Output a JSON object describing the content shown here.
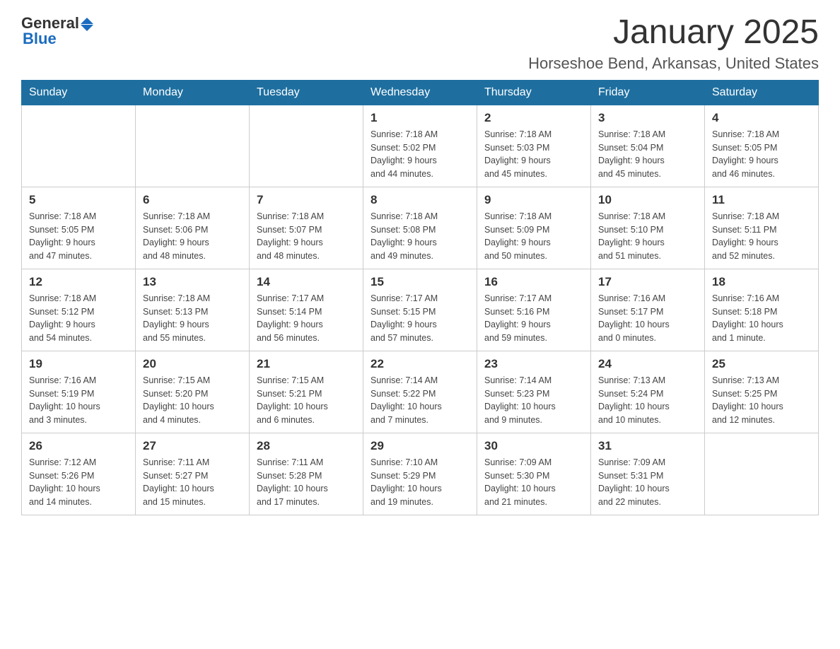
{
  "logo": {
    "general": "General",
    "blue": "Blue"
  },
  "header": {
    "month": "January 2025",
    "location": "Horseshoe Bend, Arkansas, United States"
  },
  "weekdays": [
    "Sunday",
    "Monday",
    "Tuesday",
    "Wednesday",
    "Thursday",
    "Friday",
    "Saturday"
  ],
  "weeks": [
    [
      {
        "day": "",
        "info": ""
      },
      {
        "day": "",
        "info": ""
      },
      {
        "day": "",
        "info": ""
      },
      {
        "day": "1",
        "info": "Sunrise: 7:18 AM\nSunset: 5:02 PM\nDaylight: 9 hours\nand 44 minutes."
      },
      {
        "day": "2",
        "info": "Sunrise: 7:18 AM\nSunset: 5:03 PM\nDaylight: 9 hours\nand 45 minutes."
      },
      {
        "day": "3",
        "info": "Sunrise: 7:18 AM\nSunset: 5:04 PM\nDaylight: 9 hours\nand 45 minutes."
      },
      {
        "day": "4",
        "info": "Sunrise: 7:18 AM\nSunset: 5:05 PM\nDaylight: 9 hours\nand 46 minutes."
      }
    ],
    [
      {
        "day": "5",
        "info": "Sunrise: 7:18 AM\nSunset: 5:05 PM\nDaylight: 9 hours\nand 47 minutes."
      },
      {
        "day": "6",
        "info": "Sunrise: 7:18 AM\nSunset: 5:06 PM\nDaylight: 9 hours\nand 48 minutes."
      },
      {
        "day": "7",
        "info": "Sunrise: 7:18 AM\nSunset: 5:07 PM\nDaylight: 9 hours\nand 48 minutes."
      },
      {
        "day": "8",
        "info": "Sunrise: 7:18 AM\nSunset: 5:08 PM\nDaylight: 9 hours\nand 49 minutes."
      },
      {
        "day": "9",
        "info": "Sunrise: 7:18 AM\nSunset: 5:09 PM\nDaylight: 9 hours\nand 50 minutes."
      },
      {
        "day": "10",
        "info": "Sunrise: 7:18 AM\nSunset: 5:10 PM\nDaylight: 9 hours\nand 51 minutes."
      },
      {
        "day": "11",
        "info": "Sunrise: 7:18 AM\nSunset: 5:11 PM\nDaylight: 9 hours\nand 52 minutes."
      }
    ],
    [
      {
        "day": "12",
        "info": "Sunrise: 7:18 AM\nSunset: 5:12 PM\nDaylight: 9 hours\nand 54 minutes."
      },
      {
        "day": "13",
        "info": "Sunrise: 7:18 AM\nSunset: 5:13 PM\nDaylight: 9 hours\nand 55 minutes."
      },
      {
        "day": "14",
        "info": "Sunrise: 7:17 AM\nSunset: 5:14 PM\nDaylight: 9 hours\nand 56 minutes."
      },
      {
        "day": "15",
        "info": "Sunrise: 7:17 AM\nSunset: 5:15 PM\nDaylight: 9 hours\nand 57 minutes."
      },
      {
        "day": "16",
        "info": "Sunrise: 7:17 AM\nSunset: 5:16 PM\nDaylight: 9 hours\nand 59 minutes."
      },
      {
        "day": "17",
        "info": "Sunrise: 7:16 AM\nSunset: 5:17 PM\nDaylight: 10 hours\nand 0 minutes."
      },
      {
        "day": "18",
        "info": "Sunrise: 7:16 AM\nSunset: 5:18 PM\nDaylight: 10 hours\nand 1 minute."
      }
    ],
    [
      {
        "day": "19",
        "info": "Sunrise: 7:16 AM\nSunset: 5:19 PM\nDaylight: 10 hours\nand 3 minutes."
      },
      {
        "day": "20",
        "info": "Sunrise: 7:15 AM\nSunset: 5:20 PM\nDaylight: 10 hours\nand 4 minutes."
      },
      {
        "day": "21",
        "info": "Sunrise: 7:15 AM\nSunset: 5:21 PM\nDaylight: 10 hours\nand 6 minutes."
      },
      {
        "day": "22",
        "info": "Sunrise: 7:14 AM\nSunset: 5:22 PM\nDaylight: 10 hours\nand 7 minutes."
      },
      {
        "day": "23",
        "info": "Sunrise: 7:14 AM\nSunset: 5:23 PM\nDaylight: 10 hours\nand 9 minutes."
      },
      {
        "day": "24",
        "info": "Sunrise: 7:13 AM\nSunset: 5:24 PM\nDaylight: 10 hours\nand 10 minutes."
      },
      {
        "day": "25",
        "info": "Sunrise: 7:13 AM\nSunset: 5:25 PM\nDaylight: 10 hours\nand 12 minutes."
      }
    ],
    [
      {
        "day": "26",
        "info": "Sunrise: 7:12 AM\nSunset: 5:26 PM\nDaylight: 10 hours\nand 14 minutes."
      },
      {
        "day": "27",
        "info": "Sunrise: 7:11 AM\nSunset: 5:27 PM\nDaylight: 10 hours\nand 15 minutes."
      },
      {
        "day": "28",
        "info": "Sunrise: 7:11 AM\nSunset: 5:28 PM\nDaylight: 10 hours\nand 17 minutes."
      },
      {
        "day": "29",
        "info": "Sunrise: 7:10 AM\nSunset: 5:29 PM\nDaylight: 10 hours\nand 19 minutes."
      },
      {
        "day": "30",
        "info": "Sunrise: 7:09 AM\nSunset: 5:30 PM\nDaylight: 10 hours\nand 21 minutes."
      },
      {
        "day": "31",
        "info": "Sunrise: 7:09 AM\nSunset: 5:31 PM\nDaylight: 10 hours\nand 22 minutes."
      },
      {
        "day": "",
        "info": ""
      }
    ]
  ]
}
